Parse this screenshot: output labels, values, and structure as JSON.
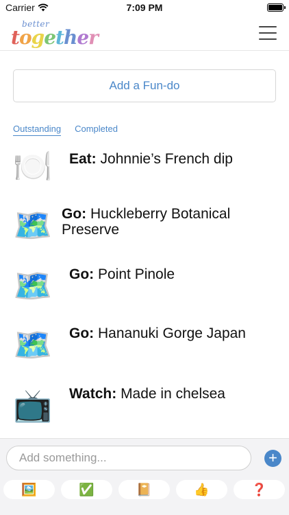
{
  "status_bar": {
    "carrier": "Carrier",
    "time": "7:09 PM"
  },
  "header": {
    "logo_small": "better",
    "logo_large": "together"
  },
  "add_button": {
    "label": "Add a Fun-do"
  },
  "tabs": [
    {
      "label": "Outstanding"
    },
    {
      "label": "Completed"
    }
  ],
  "items": [
    {
      "icon": "🍽️",
      "icon_name": "plate-icon",
      "verb": "Eat:",
      "title": "Johnnie’s French dip"
    },
    {
      "icon": "🗺️",
      "icon_name": "map-icon",
      "verb": "Go:",
      "title": "Huckleberry Botanical Preserve"
    },
    {
      "icon": "🗺️",
      "icon_name": "map-icon",
      "verb": "Go:",
      "title": "Point Pinole"
    },
    {
      "icon": "🗺️",
      "icon_name": "map-icon",
      "verb": "Go:",
      "title": "Hananuki Gorge Japan"
    },
    {
      "icon": "📺",
      "icon_name": "tv-icon",
      "verb": "Watch:",
      "title": "Made in chelsea"
    }
  ],
  "composer": {
    "placeholder": "Add something...",
    "add_icon": "+"
  },
  "quick_actions": [
    {
      "icon": "🖼️",
      "name": "picture-icon"
    },
    {
      "icon": "✅",
      "name": "check-icon"
    },
    {
      "icon": "📔",
      "name": "notebook-icon"
    },
    {
      "icon": "👍",
      "name": "thumbs-up-icon"
    },
    {
      "icon": "❓",
      "name": "question-icon"
    }
  ],
  "colors": {
    "accent": "#4a87c9",
    "logo_letters": [
      "#e0625a",
      "#f0a347",
      "#e9d44a",
      "#7cc575",
      "#5fb7d8",
      "#6a8fd0",
      "#b07ad0",
      "#e08fb5"
    ]
  }
}
